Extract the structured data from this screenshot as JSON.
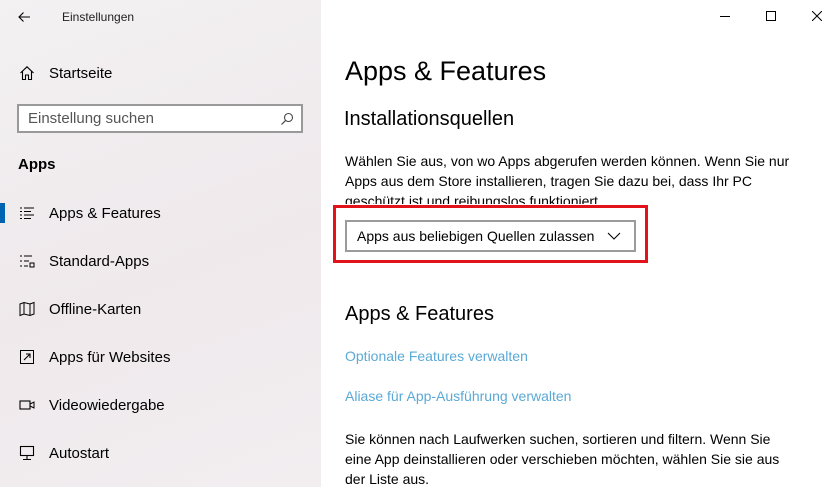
{
  "window": {
    "title": "Einstellungen",
    "back_icon": "back-arrow-icon",
    "minimize_icon": "minimize-icon",
    "maximize_icon": "maximize-icon",
    "close_icon": "close-icon"
  },
  "sidebar": {
    "home": {
      "label": "Startseite",
      "icon": "home-icon"
    },
    "search": {
      "placeholder": "Einstellung suchen",
      "icon": "search-icon"
    },
    "section_title": "Apps",
    "items": [
      {
        "label": "Apps & Features",
        "icon": "apps-features-icon",
        "selected": true
      },
      {
        "label": "Standard-Apps",
        "icon": "default-apps-icon",
        "selected": false
      },
      {
        "label": "Offline-Karten",
        "icon": "map-icon",
        "selected": false
      },
      {
        "label": "Apps für Websites",
        "icon": "apps-websites-icon",
        "selected": false
      },
      {
        "label": "Videowiedergabe",
        "icon": "video-icon",
        "selected": false
      },
      {
        "label": "Autostart",
        "icon": "startup-icon",
        "selected": false
      }
    ],
    "accent_color": "#0063b1"
  },
  "main": {
    "title": "Apps & Features",
    "install_sources": {
      "heading": "Installationsquellen",
      "description": "Wählen Sie aus, von wo Apps abgerufen werden können. Wenn Sie nur Apps aus dem Store installieren, tragen Sie dazu bei, dass Ihr PC geschützt ist und reibungslos funktioniert.",
      "dropdown_value": "Apps aus beliebigen Quellen zulassen",
      "highlight_color": "#e2131a"
    },
    "features": {
      "heading": "Apps & Features",
      "link_optional": "Optionale Features verwalten",
      "link_alias": "Aliase für App-Ausführung verwalten",
      "description": "Sie können nach Laufwerken suchen, sortieren und filtern. Wenn Sie eine App deinstallieren oder verschieben möchten, wählen Sie sie aus der Liste aus.",
      "link_color": "#5aa9d6"
    }
  }
}
